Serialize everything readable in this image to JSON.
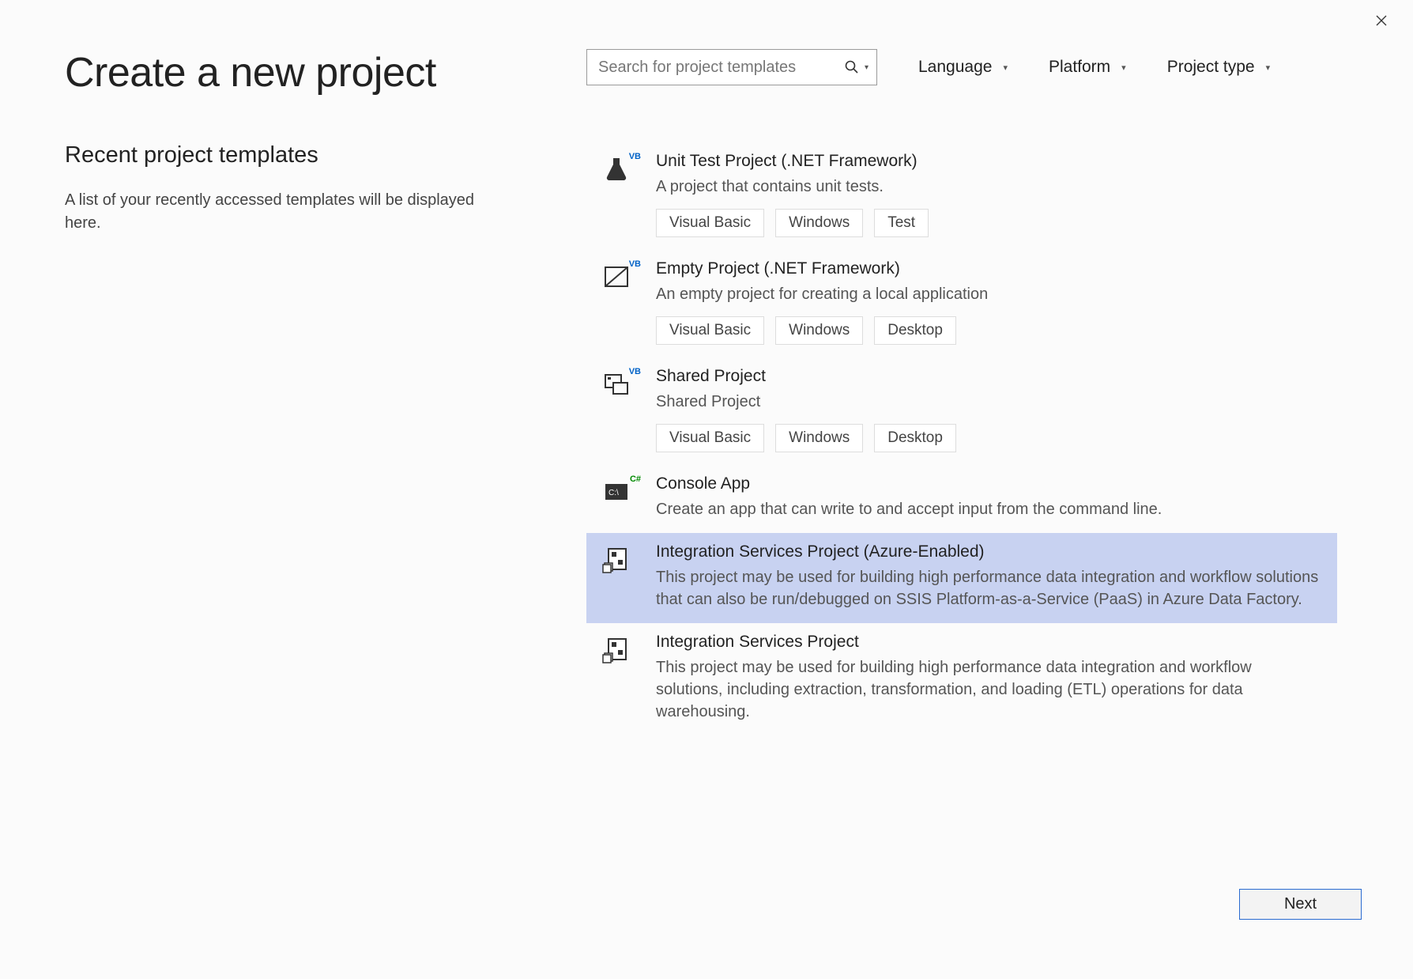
{
  "header": {
    "title": "Create a new project",
    "search_placeholder": "Search for project templates",
    "filters": {
      "language": "Language",
      "platform": "Platform",
      "project_type": "Project type"
    }
  },
  "recent": {
    "title": "Recent project templates",
    "description": "A list of your recently accessed templates will be displayed here."
  },
  "templates": [
    {
      "name": "Unit Test Project (.NET Framework)",
      "description": "A project that contains unit tests.",
      "icon": "flask",
      "badge": "VB",
      "tags": [
        "Visual Basic",
        "Windows",
        "Test"
      ],
      "selected": false
    },
    {
      "name": "Empty Project (.NET Framework)",
      "description": "An empty project for creating a local application",
      "icon": "empty",
      "badge": "VB",
      "tags": [
        "Visual Basic",
        "Windows",
        "Desktop"
      ],
      "selected": false
    },
    {
      "name": "Shared Project",
      "description": "Shared Project",
      "icon": "shared",
      "badge": "VB",
      "tags": [
        "Visual Basic",
        "Windows",
        "Desktop"
      ],
      "selected": false
    },
    {
      "name": "Console App",
      "description": "Create an app that can write to and accept input from the command line.",
      "icon": "console",
      "badge": "C#",
      "tags": [],
      "selected": false
    },
    {
      "name": "Integration Services Project (Azure-Enabled)",
      "description": "This project may be used for building high performance data integration and workflow solutions that can also be run/debugged on SSIS Platform-as-a-Service (PaaS) in Azure Data Factory.",
      "icon": "ssis",
      "badge": "",
      "tags": [],
      "selected": true
    },
    {
      "name": "Integration Services Project",
      "description": "This project may be used for building high performance data integration and workflow solutions, including extraction, transformation, and loading (ETL) operations for data warehousing.",
      "icon": "ssis",
      "badge": "",
      "tags": [],
      "selected": false
    }
  ],
  "footer": {
    "next": "Next"
  }
}
